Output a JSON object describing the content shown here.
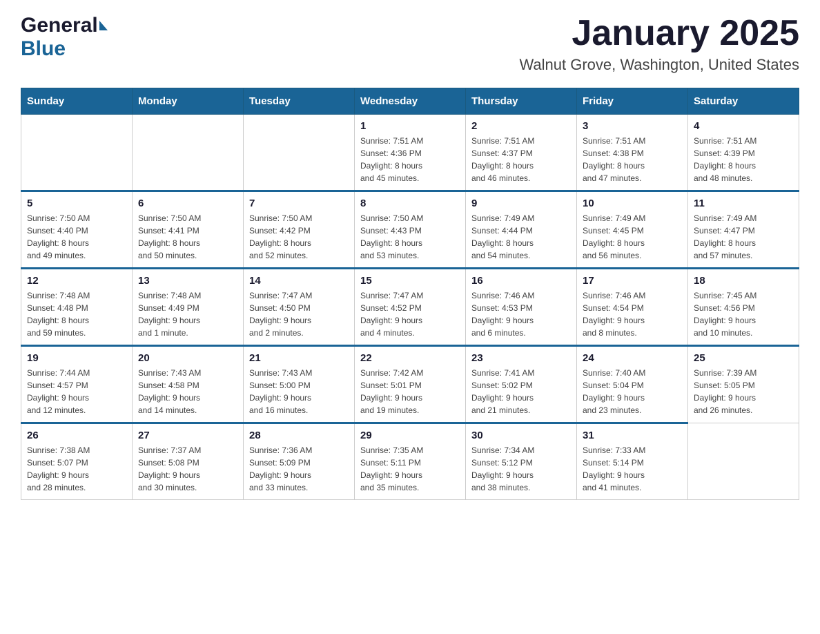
{
  "header": {
    "logo_general": "General",
    "logo_blue": "Blue",
    "title": "January 2025",
    "subtitle": "Walnut Grove, Washington, United States"
  },
  "calendar": {
    "days_of_week": [
      "Sunday",
      "Monday",
      "Tuesday",
      "Wednesday",
      "Thursday",
      "Friday",
      "Saturday"
    ],
    "weeks": [
      [
        {
          "day": "",
          "info": ""
        },
        {
          "day": "",
          "info": ""
        },
        {
          "day": "",
          "info": ""
        },
        {
          "day": "1",
          "info": "Sunrise: 7:51 AM\nSunset: 4:36 PM\nDaylight: 8 hours\nand 45 minutes."
        },
        {
          "day": "2",
          "info": "Sunrise: 7:51 AM\nSunset: 4:37 PM\nDaylight: 8 hours\nand 46 minutes."
        },
        {
          "day": "3",
          "info": "Sunrise: 7:51 AM\nSunset: 4:38 PM\nDaylight: 8 hours\nand 47 minutes."
        },
        {
          "day": "4",
          "info": "Sunrise: 7:51 AM\nSunset: 4:39 PM\nDaylight: 8 hours\nand 48 minutes."
        }
      ],
      [
        {
          "day": "5",
          "info": "Sunrise: 7:50 AM\nSunset: 4:40 PM\nDaylight: 8 hours\nand 49 minutes."
        },
        {
          "day": "6",
          "info": "Sunrise: 7:50 AM\nSunset: 4:41 PM\nDaylight: 8 hours\nand 50 minutes."
        },
        {
          "day": "7",
          "info": "Sunrise: 7:50 AM\nSunset: 4:42 PM\nDaylight: 8 hours\nand 52 minutes."
        },
        {
          "day": "8",
          "info": "Sunrise: 7:50 AM\nSunset: 4:43 PM\nDaylight: 8 hours\nand 53 minutes."
        },
        {
          "day": "9",
          "info": "Sunrise: 7:49 AM\nSunset: 4:44 PM\nDaylight: 8 hours\nand 54 minutes."
        },
        {
          "day": "10",
          "info": "Sunrise: 7:49 AM\nSunset: 4:45 PM\nDaylight: 8 hours\nand 56 minutes."
        },
        {
          "day": "11",
          "info": "Sunrise: 7:49 AM\nSunset: 4:47 PM\nDaylight: 8 hours\nand 57 minutes."
        }
      ],
      [
        {
          "day": "12",
          "info": "Sunrise: 7:48 AM\nSunset: 4:48 PM\nDaylight: 8 hours\nand 59 minutes."
        },
        {
          "day": "13",
          "info": "Sunrise: 7:48 AM\nSunset: 4:49 PM\nDaylight: 9 hours\nand 1 minute."
        },
        {
          "day": "14",
          "info": "Sunrise: 7:47 AM\nSunset: 4:50 PM\nDaylight: 9 hours\nand 2 minutes."
        },
        {
          "day": "15",
          "info": "Sunrise: 7:47 AM\nSunset: 4:52 PM\nDaylight: 9 hours\nand 4 minutes."
        },
        {
          "day": "16",
          "info": "Sunrise: 7:46 AM\nSunset: 4:53 PM\nDaylight: 9 hours\nand 6 minutes."
        },
        {
          "day": "17",
          "info": "Sunrise: 7:46 AM\nSunset: 4:54 PM\nDaylight: 9 hours\nand 8 minutes."
        },
        {
          "day": "18",
          "info": "Sunrise: 7:45 AM\nSunset: 4:56 PM\nDaylight: 9 hours\nand 10 minutes."
        }
      ],
      [
        {
          "day": "19",
          "info": "Sunrise: 7:44 AM\nSunset: 4:57 PM\nDaylight: 9 hours\nand 12 minutes."
        },
        {
          "day": "20",
          "info": "Sunrise: 7:43 AM\nSunset: 4:58 PM\nDaylight: 9 hours\nand 14 minutes."
        },
        {
          "day": "21",
          "info": "Sunrise: 7:43 AM\nSunset: 5:00 PM\nDaylight: 9 hours\nand 16 minutes."
        },
        {
          "day": "22",
          "info": "Sunrise: 7:42 AM\nSunset: 5:01 PM\nDaylight: 9 hours\nand 19 minutes."
        },
        {
          "day": "23",
          "info": "Sunrise: 7:41 AM\nSunset: 5:02 PM\nDaylight: 9 hours\nand 21 minutes."
        },
        {
          "day": "24",
          "info": "Sunrise: 7:40 AM\nSunset: 5:04 PM\nDaylight: 9 hours\nand 23 minutes."
        },
        {
          "day": "25",
          "info": "Sunrise: 7:39 AM\nSunset: 5:05 PM\nDaylight: 9 hours\nand 26 minutes."
        }
      ],
      [
        {
          "day": "26",
          "info": "Sunrise: 7:38 AM\nSunset: 5:07 PM\nDaylight: 9 hours\nand 28 minutes."
        },
        {
          "day": "27",
          "info": "Sunrise: 7:37 AM\nSunset: 5:08 PM\nDaylight: 9 hours\nand 30 minutes."
        },
        {
          "day": "28",
          "info": "Sunrise: 7:36 AM\nSunset: 5:09 PM\nDaylight: 9 hours\nand 33 minutes."
        },
        {
          "day": "29",
          "info": "Sunrise: 7:35 AM\nSunset: 5:11 PM\nDaylight: 9 hours\nand 35 minutes."
        },
        {
          "day": "30",
          "info": "Sunrise: 7:34 AM\nSunset: 5:12 PM\nDaylight: 9 hours\nand 38 minutes."
        },
        {
          "day": "31",
          "info": "Sunrise: 7:33 AM\nSunset: 5:14 PM\nDaylight: 9 hours\nand 41 minutes."
        },
        {
          "day": "",
          "info": ""
        }
      ]
    ]
  }
}
